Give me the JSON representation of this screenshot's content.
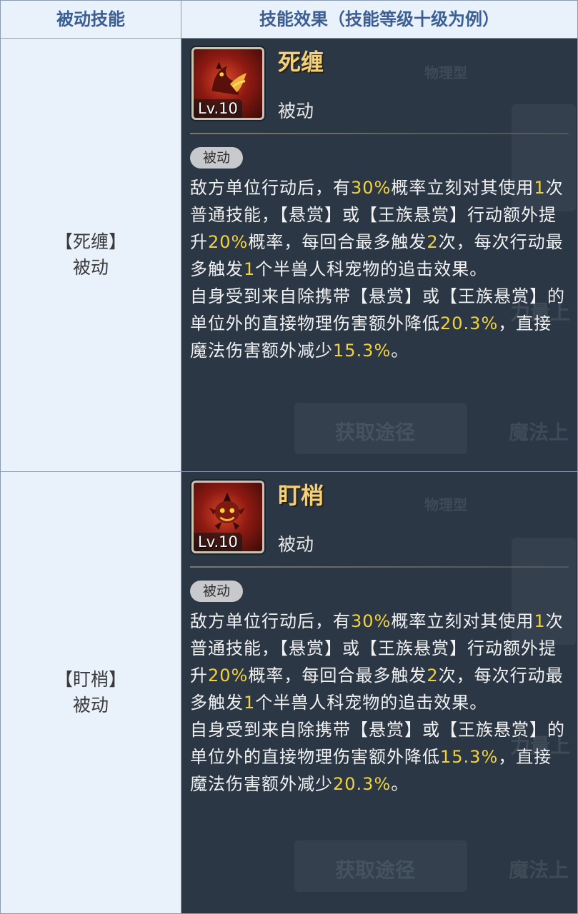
{
  "header": {
    "col1": "被动技能",
    "col2": "技能效果（技能等级十级为例）"
  },
  "rows": [
    {
      "name_line1": "【死缠】",
      "name_line2": "被动",
      "skill": {
        "name": "死缠",
        "type": "被动",
        "level": "Lv.10",
        "tag": "被动",
        "icon": "red-beast-claw-icon",
        "desc_parts": [
          [
            "敌方单位行动后，有",
            ""
          ],
          [
            "30%",
            "hl"
          ],
          [
            "概率立刻对其使用",
            ""
          ],
          [
            "1",
            "hl"
          ],
          [
            "次普通技能，【悬赏】或【王族悬赏】行动额外提升",
            ""
          ],
          [
            "20%",
            "hl"
          ],
          [
            "概率，每回合最多触发",
            ""
          ],
          [
            "2",
            "hl"
          ],
          [
            "次，每次行动最多触发",
            ""
          ],
          [
            "1",
            "hl"
          ],
          [
            "个半兽人科宠物的追击效果。",
            ""
          ]
        ],
        "desc2_parts": [
          [
            "自身受到来自除携带【悬赏】或【王族悬赏】的单位外的直接物理伤害额外降低",
            ""
          ],
          [
            "20.3%",
            "hl"
          ],
          [
            "，直接魔法伤害额外减少",
            ""
          ],
          [
            "15.3%",
            "hl"
          ],
          [
            "。",
            ""
          ]
        ]
      }
    },
    {
      "name_line1": "【盯梢】",
      "name_line2": "被动",
      "skill": {
        "name": "盯梢",
        "type": "被动",
        "level": "Lv.10",
        "tag": "被动",
        "icon": "red-goblin-face-icon",
        "desc_parts": [
          [
            "敌方单位行动后，有",
            ""
          ],
          [
            "30%",
            "hl"
          ],
          [
            "概率立刻对其使用",
            ""
          ],
          [
            "1",
            "hl"
          ],
          [
            "次普通技能，【悬赏】或【王族悬赏】行动额外提升",
            ""
          ],
          [
            "20%",
            "hl"
          ],
          [
            "概率，每回合最多触发",
            ""
          ],
          [
            "2",
            "hl"
          ],
          [
            "次，每次行动最多触发",
            ""
          ],
          [
            "1",
            "hl"
          ],
          [
            "个半兽人科宠物的追击效果。",
            ""
          ]
        ],
        "desc2_parts": [
          [
            "自身受到来自除携带【悬赏】或【王族悬赏】的单位外的直接物理伤害额外降低",
            ""
          ],
          [
            "15.3%",
            "hl"
          ],
          [
            "，直接魔法伤害额外减少",
            ""
          ],
          [
            "20.3%",
            "hl"
          ],
          [
            "。",
            ""
          ]
        ]
      }
    }
  ],
  "ghost_text": {
    "type_label": "物理型",
    "stat1": "力量上",
    "stat2": "魔法上",
    "button": "获取途径"
  },
  "colors": {
    "highlight": "#f2d23b",
    "skill_name": "#f3d17a",
    "header_text": "#3b5f95",
    "panel_bg": "#2b3744"
  }
}
